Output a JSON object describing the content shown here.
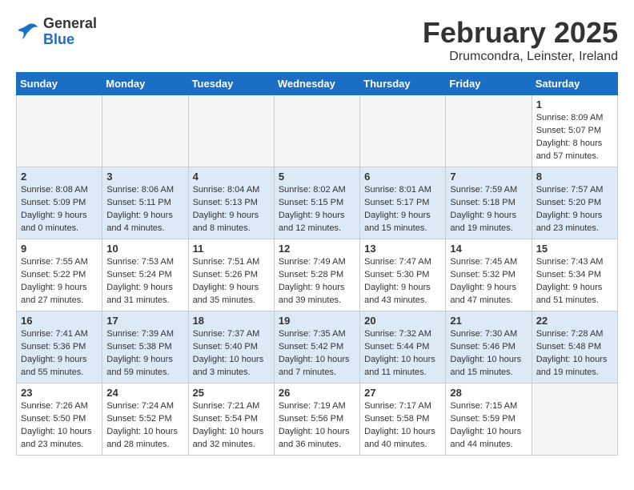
{
  "header": {
    "logo_line1": "General",
    "logo_line2": "Blue",
    "month": "February 2025",
    "location": "Drumcondra, Leinster, Ireland"
  },
  "days_of_week": [
    "Sunday",
    "Monday",
    "Tuesday",
    "Wednesday",
    "Thursday",
    "Friday",
    "Saturday"
  ],
  "weeks": [
    [
      {
        "day": "",
        "info": ""
      },
      {
        "day": "",
        "info": ""
      },
      {
        "day": "",
        "info": ""
      },
      {
        "day": "",
        "info": ""
      },
      {
        "day": "",
        "info": ""
      },
      {
        "day": "",
        "info": ""
      },
      {
        "day": "1",
        "info": "Sunrise: 8:09 AM\nSunset: 5:07 PM\nDaylight: 8 hours\nand 57 minutes."
      }
    ],
    [
      {
        "day": "2",
        "info": "Sunrise: 8:08 AM\nSunset: 5:09 PM\nDaylight: 9 hours\nand 0 minutes."
      },
      {
        "day": "3",
        "info": "Sunrise: 8:06 AM\nSunset: 5:11 PM\nDaylight: 9 hours\nand 4 minutes."
      },
      {
        "day": "4",
        "info": "Sunrise: 8:04 AM\nSunset: 5:13 PM\nDaylight: 9 hours\nand 8 minutes."
      },
      {
        "day": "5",
        "info": "Sunrise: 8:02 AM\nSunset: 5:15 PM\nDaylight: 9 hours\nand 12 minutes."
      },
      {
        "day": "6",
        "info": "Sunrise: 8:01 AM\nSunset: 5:17 PM\nDaylight: 9 hours\nand 15 minutes."
      },
      {
        "day": "7",
        "info": "Sunrise: 7:59 AM\nSunset: 5:18 PM\nDaylight: 9 hours\nand 19 minutes."
      },
      {
        "day": "8",
        "info": "Sunrise: 7:57 AM\nSunset: 5:20 PM\nDaylight: 9 hours\nand 23 minutes."
      }
    ],
    [
      {
        "day": "9",
        "info": "Sunrise: 7:55 AM\nSunset: 5:22 PM\nDaylight: 9 hours\nand 27 minutes."
      },
      {
        "day": "10",
        "info": "Sunrise: 7:53 AM\nSunset: 5:24 PM\nDaylight: 9 hours\nand 31 minutes."
      },
      {
        "day": "11",
        "info": "Sunrise: 7:51 AM\nSunset: 5:26 PM\nDaylight: 9 hours\nand 35 minutes."
      },
      {
        "day": "12",
        "info": "Sunrise: 7:49 AM\nSunset: 5:28 PM\nDaylight: 9 hours\nand 39 minutes."
      },
      {
        "day": "13",
        "info": "Sunrise: 7:47 AM\nSunset: 5:30 PM\nDaylight: 9 hours\nand 43 minutes."
      },
      {
        "day": "14",
        "info": "Sunrise: 7:45 AM\nSunset: 5:32 PM\nDaylight: 9 hours\nand 47 minutes."
      },
      {
        "day": "15",
        "info": "Sunrise: 7:43 AM\nSunset: 5:34 PM\nDaylight: 9 hours\nand 51 minutes."
      }
    ],
    [
      {
        "day": "16",
        "info": "Sunrise: 7:41 AM\nSunset: 5:36 PM\nDaylight: 9 hours\nand 55 minutes."
      },
      {
        "day": "17",
        "info": "Sunrise: 7:39 AM\nSunset: 5:38 PM\nDaylight: 9 hours\nand 59 minutes."
      },
      {
        "day": "18",
        "info": "Sunrise: 7:37 AM\nSunset: 5:40 PM\nDaylight: 10 hours\nand 3 minutes."
      },
      {
        "day": "19",
        "info": "Sunrise: 7:35 AM\nSunset: 5:42 PM\nDaylight: 10 hours\nand 7 minutes."
      },
      {
        "day": "20",
        "info": "Sunrise: 7:32 AM\nSunset: 5:44 PM\nDaylight: 10 hours\nand 11 minutes."
      },
      {
        "day": "21",
        "info": "Sunrise: 7:30 AM\nSunset: 5:46 PM\nDaylight: 10 hours\nand 15 minutes."
      },
      {
        "day": "22",
        "info": "Sunrise: 7:28 AM\nSunset: 5:48 PM\nDaylight: 10 hours\nand 19 minutes."
      }
    ],
    [
      {
        "day": "23",
        "info": "Sunrise: 7:26 AM\nSunset: 5:50 PM\nDaylight: 10 hours\nand 23 minutes."
      },
      {
        "day": "24",
        "info": "Sunrise: 7:24 AM\nSunset: 5:52 PM\nDaylight: 10 hours\nand 28 minutes."
      },
      {
        "day": "25",
        "info": "Sunrise: 7:21 AM\nSunset: 5:54 PM\nDaylight: 10 hours\nand 32 minutes."
      },
      {
        "day": "26",
        "info": "Sunrise: 7:19 AM\nSunset: 5:56 PM\nDaylight: 10 hours\nand 36 minutes."
      },
      {
        "day": "27",
        "info": "Sunrise: 7:17 AM\nSunset: 5:58 PM\nDaylight: 10 hours\nand 40 minutes."
      },
      {
        "day": "28",
        "info": "Sunrise: 7:15 AM\nSunset: 5:59 PM\nDaylight: 10 hours\nand 44 minutes."
      },
      {
        "day": "",
        "info": ""
      }
    ]
  ]
}
